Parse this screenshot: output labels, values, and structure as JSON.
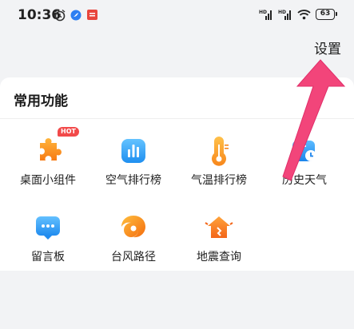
{
  "status_bar": {
    "time": "10:36",
    "battery": "63",
    "icons": [
      "alarm-icon",
      "browser-app-icon",
      "notification-app-icon",
      "hd-signal-icon",
      "hd-signal-icon",
      "wifi-icon",
      "battery-icon"
    ]
  },
  "header": {
    "settings_label": "设置"
  },
  "section": {
    "title": "常用功能",
    "badge": "HOT",
    "items": [
      {
        "label": "桌面小组件",
        "icon": "puzzle-widget-icon"
      },
      {
        "label": "空气排行榜",
        "icon": "bar-chart-icon"
      },
      {
        "label": "气温排行榜",
        "icon": "thermometer-icon"
      },
      {
        "label": "历史天气",
        "icon": "calendar-clock-icon"
      },
      {
        "label": "留言板",
        "icon": "message-board-icon"
      },
      {
        "label": "台风路径",
        "icon": "typhoon-icon"
      },
      {
        "label": "地震查询",
        "icon": "earthquake-house-icon"
      }
    ]
  },
  "colors": {
    "background": "#f2f3f5",
    "card": "#ffffff",
    "annotation_arrow": "#f2457a",
    "badge": "#f24a4a"
  }
}
